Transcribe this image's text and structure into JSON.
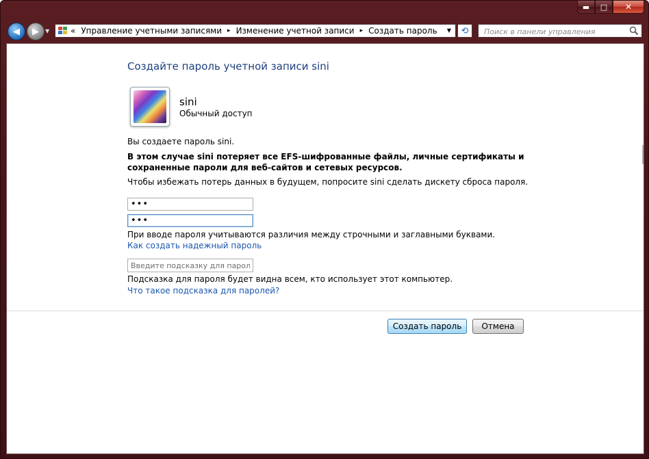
{
  "window": {
    "caption_buttons": {
      "minimize": "▬",
      "maximize": "□",
      "close": "✕"
    }
  },
  "navbar": {
    "back_icon": "back-arrow-icon",
    "forward_icon": "forward-arrow-icon",
    "address": {
      "overflow": "«",
      "crumbs": [
        "Управление учетными записями",
        "Изменение учетной записи",
        "Создать пароль"
      ],
      "separator": "▸"
    },
    "search": {
      "placeholder": "Поиск в панели управления"
    }
  },
  "main": {
    "title": "Создайте пароль учетной записи sini",
    "user": {
      "name": "sini",
      "type": "Обычный доступ"
    },
    "info": "Вы создаете пароль sini.",
    "warning": "В этом случае sini потеряет все EFS-шифрованные файлы, личные сертификаты и сохраненные пароли для веб-сайтов и сетевых ресурсов.",
    "advice": "Чтобы избежать потерь данных в будущем, попросите sini сделать дискету сброса пароля.",
    "password_value": "•••",
    "confirm_value": "•••",
    "case_note": "При вводе пароля учитываются различия между строчными и заглавными буквами.",
    "strong_link": "Как создать надежный пароль",
    "hint_placeholder": "Введите подсказку для пароля",
    "hint_note": "Подсказка для пароля будет видна всем, кто использует этот компьютер.",
    "hint_link": "Что такое подсказка для паролей?",
    "create_button": "Создать пароль",
    "cancel_button": "Отмена"
  },
  "colors": {
    "title": "#1e3f7e",
    "link": "#1a56b0",
    "frame": "#4a1418"
  }
}
